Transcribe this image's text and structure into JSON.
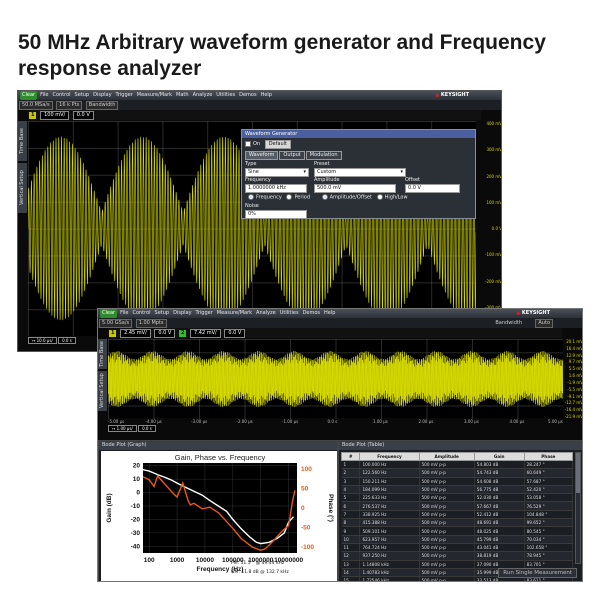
{
  "headline": "50 MHz Arbitrary waveform generator and Frequency response analyzer",
  "brand": "KEYSIGHT",
  "scope_top": {
    "menu": [
      "File",
      "Control",
      "Setup",
      "Display",
      "Trigger",
      "Measure/Mark",
      "Math",
      "Analyze",
      "Utilities",
      "Demos",
      "Help"
    ],
    "control_label": "Clear",
    "toolbar_chips": [
      "50.0 MSa/s",
      "16 k Pts",
      "Bandwidth"
    ],
    "channel": "1",
    "volts_div": "100 mV/",
    "offset": "0.0 V",
    "y_labels": [
      "400 mV",
      "300 mV",
      "200 mV",
      "100 mV",
      "0.0 V",
      "-100 mV",
      "-200 mV",
      "-300 mV",
      "-400 mV"
    ],
    "timebase": "10.0 µs/",
    "timebase_offset": "0.0 s",
    "side_tabs": [
      "Time Base",
      "Vertical Setup"
    ]
  },
  "wavegen": {
    "title": "Waveform Generator",
    "on_label": "On",
    "default_label": "Default",
    "tabs": [
      "Waveform",
      "Output",
      "Modulation"
    ],
    "type_label": "Type",
    "type_value": "Sine",
    "preset_label": "Preset",
    "preset_value": "Custom",
    "frequency_label": "Frequency",
    "frequency_value": "1.0000000 kHz",
    "amplitude_label": "Amplitude",
    "amplitude_value": "500.0 mV",
    "offset_label": "Offset",
    "offset_value": "0.0 V",
    "radio_frequency": "Frequency",
    "radio_period": "Period",
    "radio_ampoffset": "Amplitude/Offset",
    "radio_highlow": "High/Low",
    "noise_label": "Noise",
    "noise_value": "0%"
  },
  "scope_bottom": {
    "menu": [
      "File",
      "Control",
      "Setup",
      "Display",
      "Trigger",
      "Measure/Mark",
      "Analyze",
      "Utilities",
      "Demos",
      "Help"
    ],
    "control_label": "Clear",
    "toolbar_chips": [
      "5.00 GSa/s",
      "1.00 Mpts"
    ],
    "bandwidth_label": "Bandwidth",
    "auto_label": "Auto",
    "channel_volts": "2.45 mV/",
    "channel_offset": "0.0 V",
    "channel2_volts": "7.42 mV/",
    "channel2_offset": "0.0 V",
    "y_labels": [
      "20.1 mV",
      "16.4 mV",
      "12.9 mV",
      "9.7 mV",
      "5.5 mV",
      "1.6 mV",
      "-1.9 mV",
      "-5.5 mV",
      "-9.1 mV",
      "-12.7 mV",
      "-16.4 mV",
      "-21.9 mV"
    ],
    "x_labels": [
      "-5.00 µs",
      "-4.00 µs",
      "-3.00 µs",
      "-2.00 µs",
      "-1.00 µs",
      "0.0 s",
      "1.00 µs",
      "2.00 µs",
      "3.00 µs",
      "4.00 µs",
      "5.00 µs"
    ],
    "timebase": "1.00 µs/",
    "timebase_offset": "0.0 s",
    "side_tabs": [
      "Time Base",
      "Vertical Setup"
    ]
  },
  "bode_graph": {
    "panel_title": "Bode Plot (Graph)",
    "title": "Gain, Phase vs. Frequency",
    "xlabel": "Frequency (Hz)",
    "ylabel_left": "Gain (dB)",
    "ylabel_right": "Phase (°)",
    "pm_label": "PM:",
    "pm_value": "51.5 °",
    "pm_freq": "@ 49.44 kHz",
    "gm_label": "GM:",
    "gm_value": "11.8 dB",
    "gm_freq": "@ 132.7 kHz",
    "colors": {
      "gain": "#ffffff",
      "phase": "#e8581c",
      "plot_bg": "#000000",
      "page_bg": "#ffffff"
    }
  },
  "chart_data": {
    "type": "line",
    "title": "Gain, Phase vs. Frequency",
    "xlabel": "Frequency (Hz)",
    "ylabel": "Gain (dB)",
    "y2label": "Phase (°)",
    "xscale": "log",
    "x_ticks": [
      "100",
      "1000",
      "10000",
      "100000",
      "1000000",
      "10000000"
    ],
    "y_ticks": [
      20,
      10,
      0,
      -10,
      -20,
      -30,
      -40
    ],
    "y2_ticks": [
      100,
      50,
      0,
      -50,
      -100
    ],
    "xlim": [
      60,
      20000000
    ],
    "ylim": [
      -45,
      22
    ],
    "y2lim": [
      -115,
      115
    ],
    "grid": true,
    "series": [
      {
        "name": "Gain",
        "axis": "left",
        "x": [
          60,
          100,
          150,
          220,
          350,
          600,
          1000,
          2000,
          4000,
          8000,
          15000,
          30000,
          60000,
          100000,
          200000,
          400000,
          700000,
          1000000,
          2000000,
          4000000,
          7000000,
          10000000,
          15000000
        ],
        "y": [
          17,
          16,
          14.5,
          13,
          11.5,
          9.5,
          7,
          4,
          1,
          -2,
          -6,
          -10,
          -14,
          -20,
          -27,
          -33,
          -37,
          -38,
          -37,
          -34,
          -30,
          -22,
          -18
        ]
      },
      {
        "name": "Phase",
        "axis": "right",
        "x": [
          60,
          100,
          150,
          200,
          280,
          400,
          700,
          1000,
          1600,
          2500,
          3000,
          4000,
          8000,
          15000,
          30000,
          60000,
          100000,
          200000,
          500000,
          1000000,
          1500000,
          3000000,
          6000000,
          10000000,
          14000000,
          17000000
        ],
        "y": [
          80,
          72,
          55,
          82,
          70,
          58,
          38,
          28,
          64,
          18,
          8,
          12,
          -2,
          2,
          -12,
          -35,
          -52,
          -78,
          -100,
          -108,
          -104,
          -82,
          -58,
          -45,
          20,
          45
        ]
      }
    ]
  },
  "bode_table": {
    "panel_title": "Bode Plot (Table)",
    "columns": [
      "#",
      "Frequency",
      "Amplitude",
      "Gain",
      "Phase"
    ],
    "rows": [
      [
        "1",
        "100.000 Hz",
        "500 mV p-p",
        "54.803 dB",
        "28.247 °"
      ],
      [
        "2",
        "122.560 Hz",
        "500 mV p-p",
        "54.743 dB",
        "60.649 °"
      ],
      [
        "3",
        "150.211 Hz",
        "500 mV p-p",
        "54.608 dB",
        "57.687 °"
      ],
      [
        "4",
        "184.099 Hz",
        "500 mV p-p",
        "56.775 dB",
        "52.420 °"
      ],
      [
        "5",
        "225.633 Hz",
        "500 mV p-p",
        "52.030 dB",
        "53.058 °"
      ],
      [
        "6",
        "276.537 Hz",
        "500 mV p-p",
        "57.667 dB",
        "76.529 °"
      ],
      [
        "7",
        "338.925 Hz",
        "500 mV p-p",
        "52.412 dB",
        "104.848 °"
      ],
      [
        "8",
        "415.388 Hz",
        "500 mV p-p",
        "48.691 dB",
        "99.652 °"
      ],
      [
        "9",
        "509.101 Hz",
        "500 mV p-p",
        "48.025 dB",
        "80.545 °"
      ],
      [
        "10",
        "623.957 Hz",
        "500 mV p-p",
        "45.799 dB",
        "70.034 °"
      ],
      [
        "11",
        "764.724 Hz",
        "500 mV p-p",
        "43.041 dB",
        "102.658 °"
      ],
      [
        "12",
        "937.250 Hz",
        "500 mV p-p",
        "38.819 dB",
        "78.945 °"
      ],
      [
        "13",
        "1.14808 kHz",
        "500 mV p-p",
        "37.090 dB",
        "83.701 °"
      ],
      [
        "14",
        "1.40783 kHz",
        "500 mV p-p",
        "35.999 dB",
        "87.935 °"
      ],
      [
        "15",
        "1.72546 kHz",
        "500 mV p-p",
        "33.513 dB",
        "83.611 °"
      ]
    ],
    "run_button": "Run Single Measurement"
  }
}
